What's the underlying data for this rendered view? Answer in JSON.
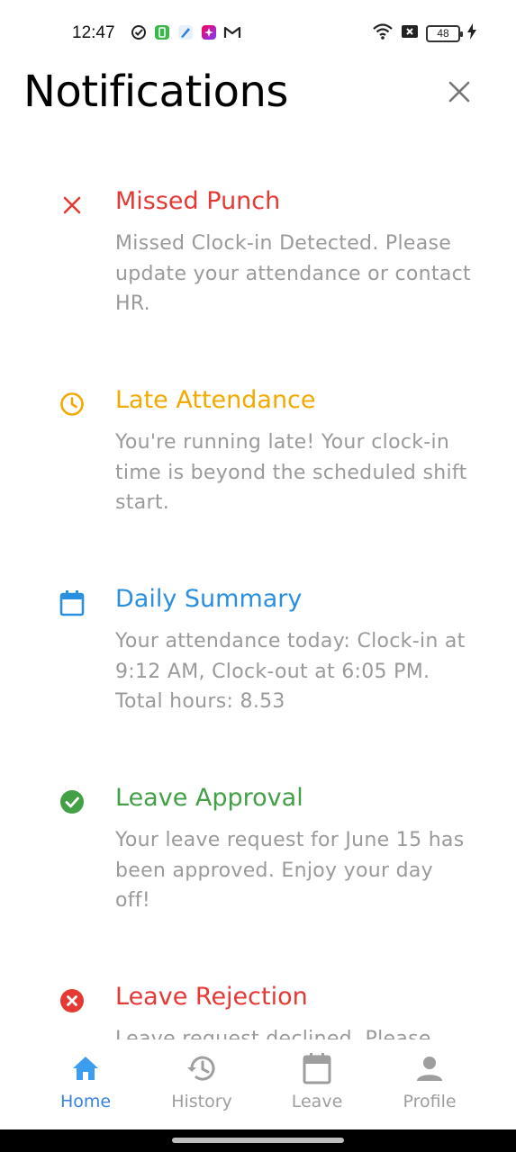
{
  "status_bar": {
    "time": "12:47",
    "battery": "48",
    "left_icons": [
      "check-circle-icon",
      "green-app-icon",
      "blue-app-icon",
      "gradient-app-icon",
      "gmail-icon"
    ],
    "right_icons": [
      "wifi-icon",
      "sim-x-icon",
      "battery-icon",
      "charging-bolt-icon"
    ]
  },
  "header": {
    "title": "Notifications",
    "close_icon": "close-icon"
  },
  "colors": {
    "red": "#e53935",
    "amber": "#f2a900",
    "blue": "#2b8fe0",
    "green": "#43a047",
    "body_text": "#9a9a9a",
    "nav_active": "#3b82e0",
    "nav_inactive": "#9e9e9e"
  },
  "notifications": [
    {
      "icon": "x-mark-icon",
      "title": "Missed Punch",
      "body": "Missed Clock-in Detected. Please update your attendance or contact HR."
    },
    {
      "icon": "clock-icon",
      "title": "Late Attendance",
      "body": "You're running late! Your clock-in time is beyond the scheduled shift start."
    },
    {
      "icon": "calendar-icon",
      "title": "Daily Summary",
      "body": "Your attendance today: Clock-in at 9:12 AM, Clock-out at 6:05 PM. Total hours: 8.53"
    },
    {
      "icon": "check-circle-icon",
      "title": "Leave Approval",
      "body": "Your leave request for June 15 has been approved. Enjoy your day off!"
    },
    {
      "icon": "cancel-circle-icon",
      "title": "Leave Rejection",
      "body": "Leave request declined. Please"
    }
  ],
  "bottom_nav": [
    {
      "label": "Home",
      "icon": "home-icon",
      "active": true
    },
    {
      "label": "History",
      "icon": "history-icon",
      "active": false
    },
    {
      "label": "Leave",
      "icon": "calendar-icon",
      "active": false
    },
    {
      "label": "Profile",
      "icon": "person-icon",
      "active": false
    }
  ]
}
